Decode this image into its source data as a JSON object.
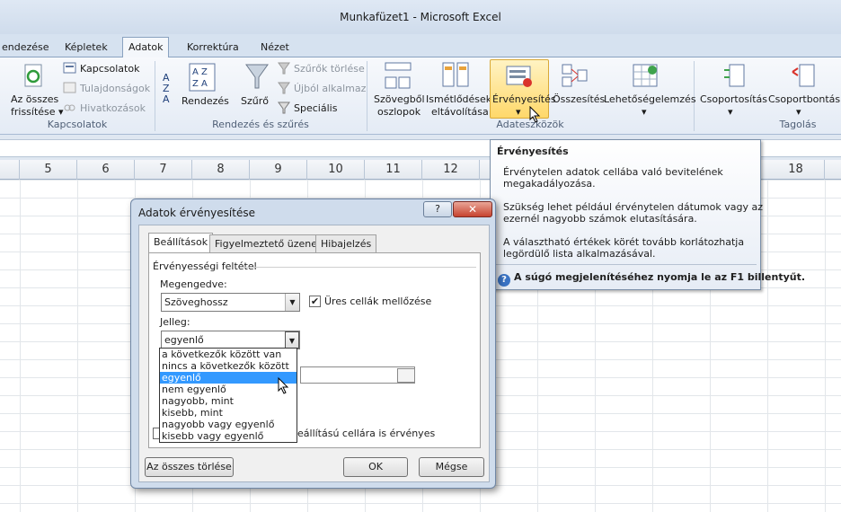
{
  "window": {
    "title": "Munkafüzet1  -  Microsoft Excel"
  },
  "tabs": [
    {
      "label": "endezése"
    },
    {
      "label": "Képletek"
    },
    {
      "label": "Adatok"
    },
    {
      "label": "Korrektúra"
    },
    {
      "label": "Nézet"
    }
  ],
  "ribbon": {
    "kapcsolatok": {
      "refresh_line1": "Az összes",
      "refresh_line2": "frissítése ▾",
      "connections": "Kapcsolatok",
      "properties": "Tulajdonságok",
      "links": "Hivatkozások",
      "group": "Kapcsolatok"
    },
    "rendezes": {
      "sort_az": "A→Z",
      "sort": "Rendezés",
      "filter": "Szűrő",
      "clear": "Szűrők törlése",
      "reapply": "Újból alkalmaz",
      "advanced": "Speciális",
      "group": "Rendezés és szűrés"
    },
    "adateszkozok": {
      "text_to_col_1": "Szövegből",
      "text_to_col_2": "oszlopok",
      "remove_dup_1": "Ismétlődések",
      "remove_dup_2": "eltávolítása",
      "validation": "Érvényesítés",
      "validation_arrow": "▾",
      "consolidate": "Összesítés",
      "whatif": "Lehetőségelemzés",
      "whatif_arrow": "▾",
      "group": "Adateszközök"
    },
    "tagolas": {
      "group_btn": "Csoportosítás",
      "ungroup_btn": "Csoportbontás",
      "arrow": "▾",
      "group": "Tagolás"
    }
  },
  "columns": [
    "5",
    "6",
    "7",
    "8",
    "9",
    "10",
    "11",
    "12",
    "18"
  ],
  "tooltip": {
    "title": "Érvényesítés",
    "p1a": "Érvénytelen adatok cellába való bevitelének",
    "p1b": "megakadályozása.",
    "p2a": "Szükség lehet például érvénytelen dátumok vagy az",
    "p2b": "ezernél nagyobb számok elutasítására.",
    "p3a": "A választható értékek körét tovább korlátozhatja",
    "p3b": "legördülő lista alkalmazásával.",
    "help": "A súgó megjelenítéséhez nyomja le az F1 billentyűt."
  },
  "dialog": {
    "title": "Adatok érvényesítése",
    "help_btn": "?",
    "close_btn": "✕",
    "tabs": [
      "Beállítások",
      "Figyelmeztető üzenet",
      "Hibajelzés"
    ],
    "criteria_label": "Érvényességi feltétel",
    "allow_label": "Megengedve:",
    "allow_value": "Szöveghossz",
    "ignore_blank": "Üres cellák mellőzése",
    "data_label": "Jelleg:",
    "data_value": "egyenlő",
    "options": [
      "a következők között van",
      "nincs a következők között",
      "egyenlő",
      "nem egyenlő",
      "nagyobb, mint",
      "kisebb, mint",
      "nagyobb vagy egyenlő",
      "kisebb vagy egyenlő"
    ],
    "selected_option": "egyenlő",
    "apply_text": "eállítású cellára is érvényes",
    "clear_all": "Az összes törlése",
    "ok": "OK",
    "cancel": "Mégse"
  }
}
